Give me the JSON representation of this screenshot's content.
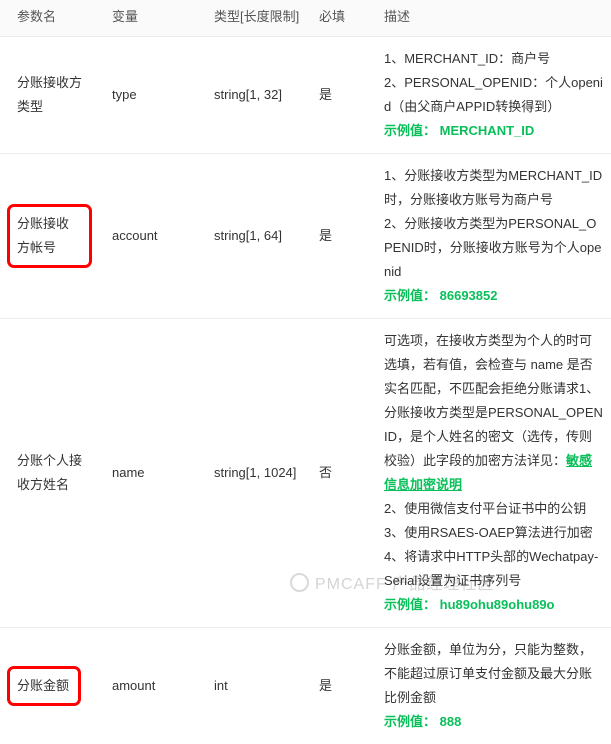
{
  "table": {
    "headers": [
      "参数名",
      "变量",
      "类型[长度限制]",
      "必填",
      "描述"
    ],
    "rows": [
      {
        "param_name": "分账接收方类型",
        "variable": "type",
        "type": "string[1, 32]",
        "required": "是",
        "desc_lines": [
          "1、MERCHANT_ID：商户号",
          "2、PERSONAL_OPENID：个人openid（由父商户APPID转换得到）"
        ],
        "example_label": "示例值：",
        "example_value": "MERCHANT_ID",
        "highlighted": false
      },
      {
        "param_name": "分账接收方帐号",
        "variable": "account",
        "type": "string[1, 64]",
        "required": "是",
        "desc_lines": [
          "1、分账接收方类型为MERCHANT_ID时，分账接收方账号为商户号",
          "2、分账接收方类型为PERSONAL_OPENID时，分账接收方账号为个人openid"
        ],
        "example_label": "示例值：",
        "example_value": "86693852",
        "highlighted": true
      },
      {
        "param_name": "分账个人接收方姓名",
        "variable": "name",
        "type": "string[1, 1024]",
        "required": "否",
        "desc_lines": [
          "可选项，在接收方类型为个人的时可选填，若有值，会检查与 name 是否实名匹配，不匹配会拒绝分账请求",
          "1、分账接收方类型是PERSONAL_OPENID，是个人姓名的密文（选传，传则校验）此字段的加密方法详见：",
          "2、使用微信支付平台证书中的公钥",
          "3、使用RSAES-OAEP算法进行加密",
          "4、将请求中HTTP头部的Wechatpay-Serial设置为证书序列号"
        ],
        "inline_link": "敏感信息加密说明",
        "example_label": "示例值：",
        "example_value": "hu89ohu89ohu89o",
        "highlighted": false
      },
      {
        "param_name": "分账金额",
        "variable": "amount",
        "type": "int",
        "required": "是",
        "desc_lines": [
          "分账金额，单位为分，只能为整数，不能超过原订单支付金额及最大分账比例金额"
        ],
        "example_label": "示例值：",
        "example_value": "888",
        "highlighted": true
      }
    ]
  },
  "watermark": {
    "text": "PMCAFF 产品经理社区",
    "logo": "pmcaff-circle-logo"
  },
  "colors": {
    "accent_green": "#09bf5a",
    "highlight_red": "#ff0000",
    "header_bg": "#fafafa",
    "divider": "#ececec"
  }
}
